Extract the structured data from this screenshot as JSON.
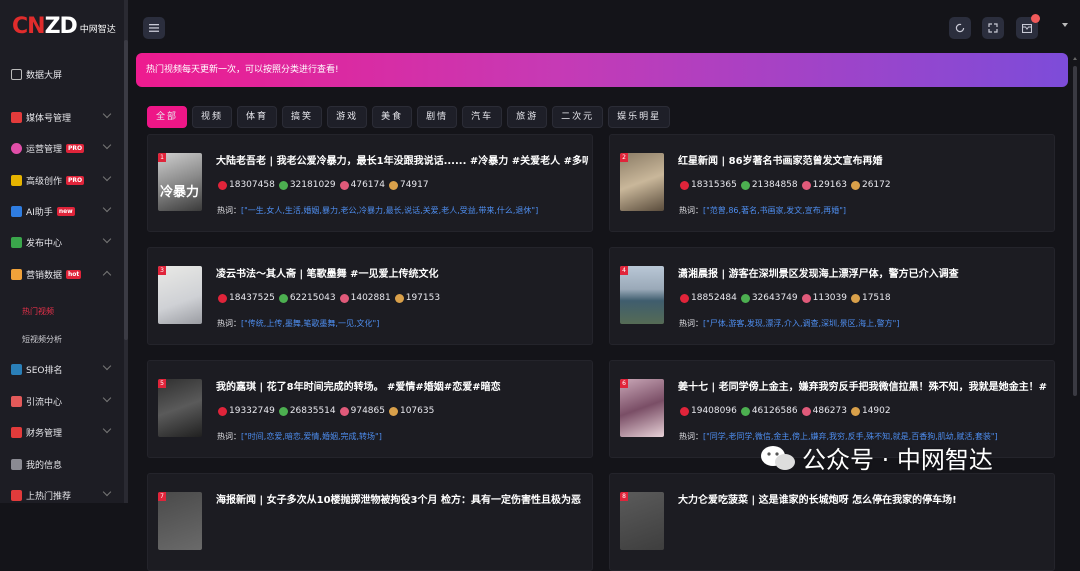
{
  "logo": {
    "mark_c": "C",
    "mark_n": "N",
    "mark_z": "Z",
    "mark_d": "D",
    "text": "中网智达"
  },
  "sidebar": {
    "items": [
      {
        "label": "数据大屏",
        "icon": "monitor-icon",
        "color": "#bbbbbb"
      },
      {
        "label": "媒体号管理",
        "icon": "media-icon",
        "color": "#e33b3b"
      },
      {
        "label": "运营管理",
        "icon": "operation-icon",
        "color": "#e04ea8",
        "badge": "PRO"
      },
      {
        "label": "高级创作",
        "icon": "create-icon",
        "color": "#e6b400",
        "badge": "PRO"
      },
      {
        "label": "AI助手",
        "icon": "ai-icon",
        "color": "#2f7de1",
        "badge": "new"
      },
      {
        "label": "发布中心",
        "icon": "publish-icon",
        "color": "#3aa64b"
      },
      {
        "label": "营销数据",
        "icon": "chart-icon",
        "color": "#f0a23a",
        "badge": "hot"
      },
      {
        "label": "SEO排名",
        "icon": "seo-icon",
        "color": "#2a7fb8"
      },
      {
        "label": "引流中心",
        "icon": "traffic-icon",
        "color": "#e35a5a"
      },
      {
        "label": "财务管理",
        "icon": "finance-icon",
        "color": "#e23b3b"
      },
      {
        "label": "我的信息",
        "icon": "user-icon",
        "color": "#8a8a92"
      },
      {
        "label": "上热门推荐",
        "icon": "fire-icon",
        "color": "#e23b3b"
      }
    ],
    "sub_items": [
      "热门视频",
      "短视频分析"
    ]
  },
  "notice": "热门视频每天更新一次，可以按照分类进行查看!",
  "tabs": [
    "全部",
    "视频",
    "体育",
    "搞笑",
    "游戏",
    "美食",
    "剧情",
    "汽车",
    "旅游",
    "二次元",
    "娱乐明星"
  ],
  "hot_label": "热词：",
  "cards": [
    {
      "rank": "1",
      "title": "大陆老吾老 | 我老公爱冷暴力，最长1年没跟我说话...... #冷暴力 #关爱老人 #多听",
      "s1": "18307458",
      "s2": "32181029",
      "s3": "476174",
      "s4": "74917",
      "keywords": "[\"一生,女人,生活,婚姻,暴力,老公,冷暴力,最长,说话,关爱,老人,受益,带来,什么,退休\"]",
      "thumb_text": "冷暴力"
    },
    {
      "rank": "2",
      "title": "红星新闻 | 86岁著名书画家范曾发文宣布再婚",
      "s1": "18315365",
      "s2": "21384858",
      "s3": "129163",
      "s4": "26172",
      "keywords": "[\"范曾,86,著名,书画家,发文,宣布,再婚\"]",
      "thumb_text": ""
    },
    {
      "rank": "3",
      "title": "凌云书法～其人斋 | 笔歌墨舞 #一见爱上传统文化",
      "s1": "18437525",
      "s2": "62215043",
      "s3": "1402881",
      "s4": "197153",
      "keywords": "[\"传统,上传,墨舞,笔歌墨舞,一见,文化\"]",
      "thumb_text": ""
    },
    {
      "rank": "4",
      "title": "潇湘晨报 | 游客在深圳景区发现海上漂浮尸体，警方已介入调查",
      "s1": "18852484",
      "s2": "32643749",
      "s3": "113039",
      "s4": "17518",
      "keywords": "[\"尸体,游客,发现,漂浮,介入,调查,深圳,景区,海上,警方\"]",
      "thumb_text": ""
    },
    {
      "rank": "5",
      "title": "我的嘉琪 | 花了8年时间完成的转场。 #爱情#婚姻#恋爱#暗恋",
      "s1": "19332749",
      "s2": "26835514",
      "s3": "974865",
      "s4": "107635",
      "keywords": "[\"时间,恋爱,暗恋,爱情,婚姻,完成,转场\"]",
      "thumb_text": ""
    },
    {
      "rank": "6",
      "title": "姜十七 | 老同学傍上金主，嫌弃我穷反手把我微信拉黑！殊不知，我就是她金主！#",
      "s1": "19408096",
      "s2": "46126586",
      "s3": "486273",
      "s4": "14902",
      "keywords": "[\"同学,老同学,微信,金主,傍上,嫌弃,我穷,反手,殊不知,就是,百香狗,肌幼,赋活,套装\"]",
      "thumb_text": ""
    },
    {
      "rank": "7",
      "title": "海报新闻 | 女子多次从10楼抛掷泄物被拘役3个月 检方：具有一定伤害性且极为恶",
      "s1": "",
      "s2": "",
      "s3": "",
      "s4": "",
      "keywords": "",
      "thumb_text": ""
    },
    {
      "rank": "8",
      "title": "大力仑爱吃菠菜 | 这是谁家的长城炮呀 怎么停在我家的停车场!",
      "s1": "",
      "s2": "",
      "s3": "",
      "s4": "",
      "keywords": "",
      "thumb_text": ""
    }
  ],
  "watermark": "公众号 · 中网智达",
  "colors": {
    "accent": "#ee1687",
    "link": "#4e8ef0",
    "panel": "#1c1c22",
    "bg": "#141419"
  }
}
